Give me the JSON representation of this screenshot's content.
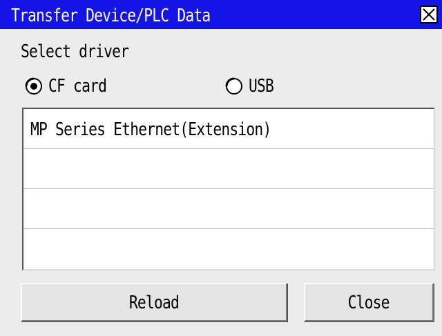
{
  "window": {
    "title": "Transfer Device/PLC Data",
    "title_bar_color": "#1414e6",
    "close_icon": "close-x-icon"
  },
  "driver": {
    "label": "Select driver",
    "options": [
      {
        "label": "CF card",
        "selected": true
      },
      {
        "label": "USB",
        "selected": false
      }
    ]
  },
  "list": {
    "rows": [
      "MP Series Ethernet(Extension)",
      "",
      "",
      ""
    ]
  },
  "buttons": {
    "reload_label": "Reload",
    "close_label": "Close"
  }
}
